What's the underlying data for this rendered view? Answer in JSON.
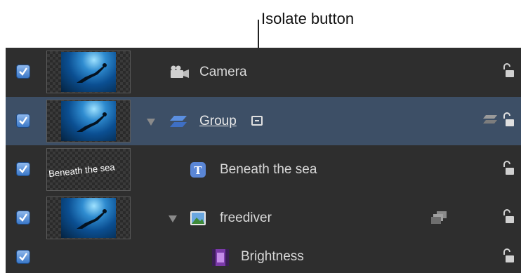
{
  "callout": {
    "label": "Isolate button"
  },
  "layers": [
    {
      "name": "Camera",
      "type": "camera",
      "checked": true,
      "thumbnail": "photo"
    },
    {
      "name": "Group",
      "type": "group",
      "checked": true,
      "thumbnail": "photo",
      "selected": true,
      "expanded": true
    },
    {
      "name": "Beneath the sea",
      "type": "text",
      "checked": true,
      "thumbnail": "text",
      "thumbnail_text": "Beneath the sea"
    },
    {
      "name": "freediver",
      "type": "image",
      "checked": true,
      "thumbnail": "photo",
      "expanded": true
    },
    {
      "name": "Brightness",
      "type": "filter",
      "checked": true
    }
  ],
  "colors": {
    "panel_bg": "#2e2e2e",
    "selected_row": "#3d4f66",
    "checkbox": "#3b78c8"
  }
}
